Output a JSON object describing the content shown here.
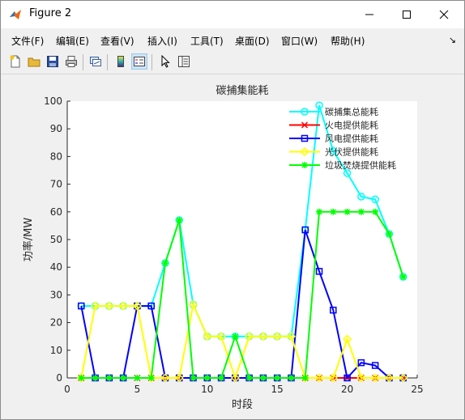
{
  "window": {
    "title": "Figure 2"
  },
  "menu": [
    "文件(F)",
    "编辑(E)",
    "查看(V)",
    "插入(I)",
    "工具(T)",
    "桌面(D)",
    "窗口(W)",
    "帮助(H)"
  ],
  "toolbar": [
    "new-figure",
    "open-file",
    "save",
    "print",
    "link-plot",
    "insert-colorbar",
    "insert-legend",
    "edit-plot",
    "property-inspector"
  ],
  "chart_data": {
    "type": "line",
    "title": "碳捕集能耗",
    "xlabel": "时段",
    "ylabel": "功率/MW",
    "xlim": [
      0,
      25
    ],
    "ylim": [
      0,
      100
    ],
    "xticks": [
      0,
      5,
      10,
      15,
      20,
      25
    ],
    "yticks": [
      0,
      10,
      20,
      30,
      40,
      50,
      60,
      70,
      80,
      90,
      100
    ],
    "x": [
      1,
      2,
      3,
      4,
      5,
      6,
      7,
      8,
      9,
      10,
      11,
      12,
      13,
      14,
      15,
      16,
      17,
      18,
      19,
      20,
      21,
      22,
      23,
      24
    ],
    "legend_position": "top-right",
    "series": [
      {
        "name": "碳捕集总能耗",
        "color": "#00ffff",
        "marker": "circle",
        "values": [
          26,
          26,
          26,
          26,
          26,
          26,
          41.5,
          57,
          26.5,
          15,
          15,
          15,
          15,
          15,
          15,
          15,
          53.5,
          98.5,
          82,
          74,
          65.5,
          64.5,
          52,
          36.5
        ]
      },
      {
        "name": "火电提供能耗",
        "color": "#ff0000",
        "marker": "x",
        "values": [
          0,
          0,
          0,
          0,
          0,
          0,
          0,
          0,
          0,
          0,
          0,
          0,
          0,
          0,
          0,
          0,
          0,
          0,
          0,
          0,
          0,
          0,
          0,
          0
        ]
      },
      {
        "name": "风电提供能耗",
        "color": "#0000ff",
        "marker": "square",
        "values": [
          26,
          0,
          0,
          0,
          26,
          26,
          0,
          0,
          0,
          0,
          0,
          0,
          0,
          0,
          0,
          0,
          53.5,
          38.5,
          24.5,
          0,
          5.5,
          4.5,
          0,
          0
        ]
      },
      {
        "name": "光伏提供能耗",
        "color": "#ffff00",
        "marker": "diamond",
        "values": [
          0,
          26,
          26,
          26,
          26,
          0,
          0,
          0,
          26.5,
          15,
          15,
          0,
          15,
          15,
          15,
          15,
          0,
          0,
          0,
          14,
          0,
          0,
          0,
          0
        ]
      },
      {
        "name": "垃圾焚烧提供能耗",
        "color": "#00ff00",
        "marker": "star",
        "values": [
          0,
          0,
          0,
          0,
          0,
          0,
          41.5,
          57,
          0,
          0,
          0,
          15,
          0,
          0,
          0,
          0,
          0,
          60,
          60,
          60,
          60,
          60,
          52,
          36.5
        ]
      }
    ]
  }
}
